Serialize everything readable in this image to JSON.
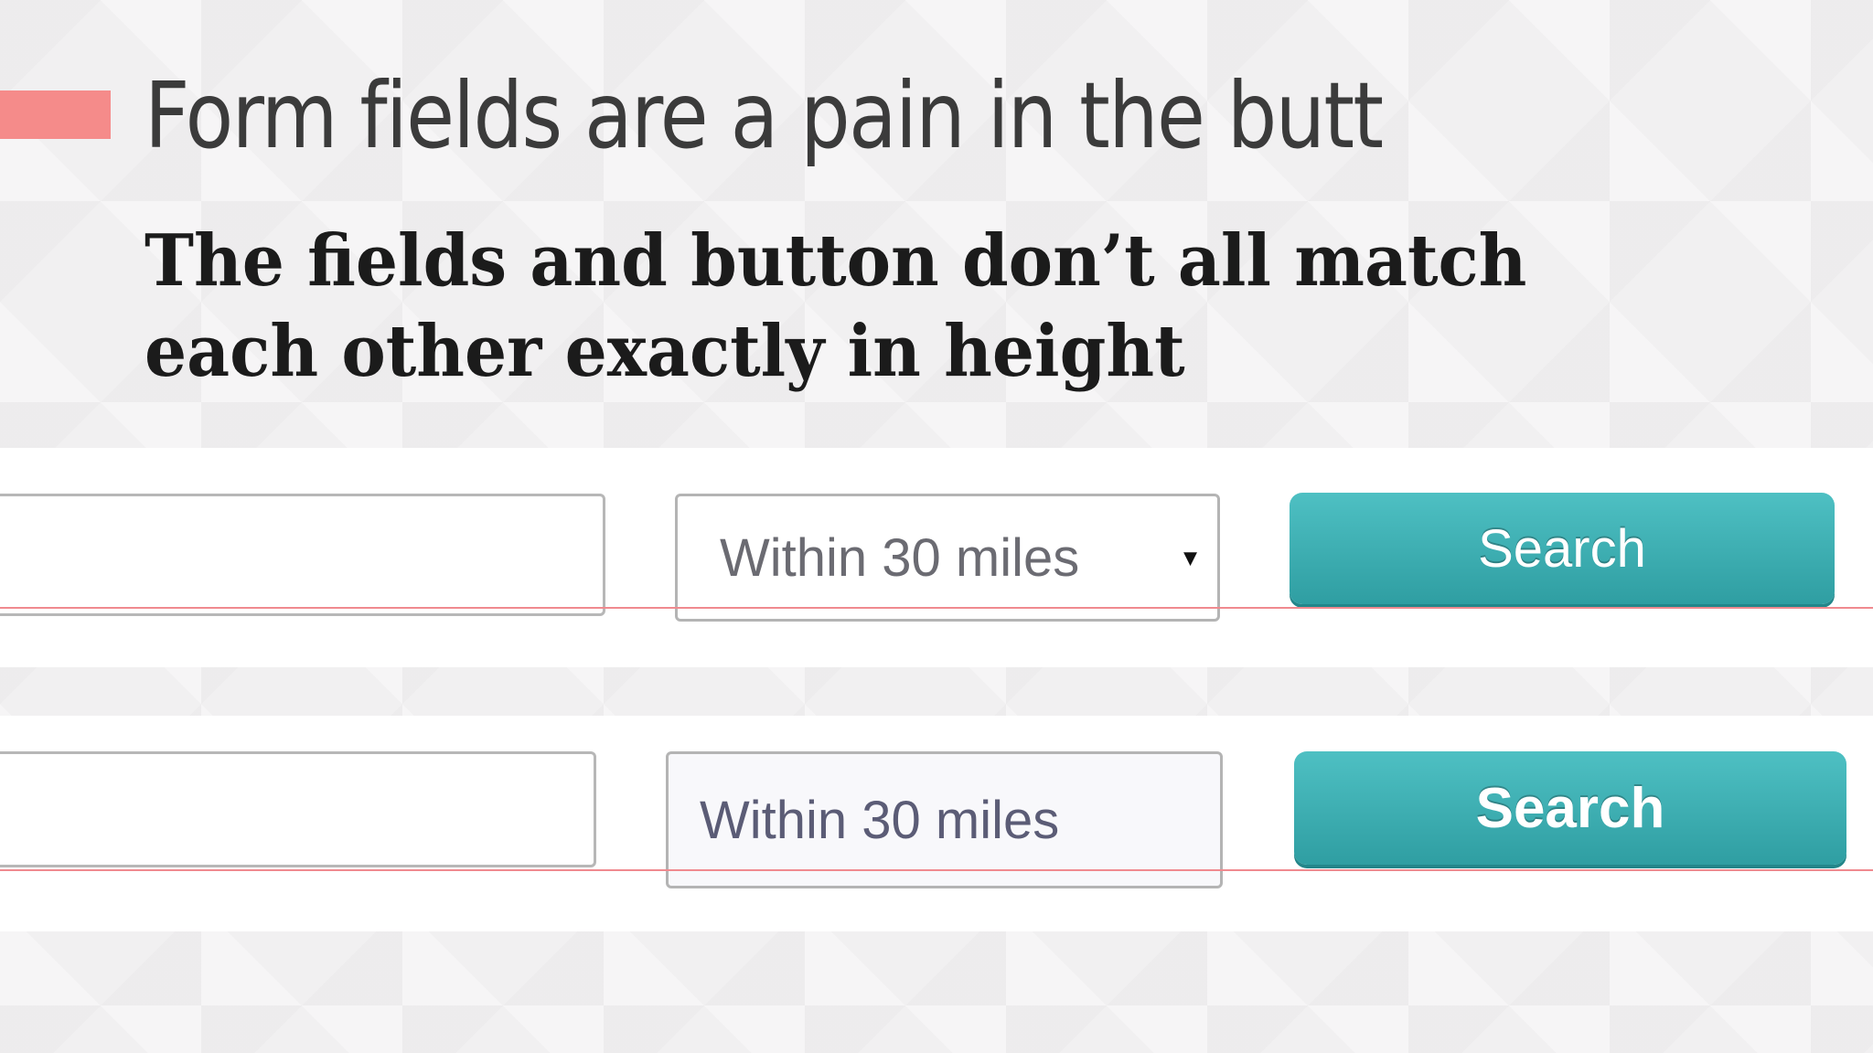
{
  "slide": {
    "title": "Form fields are a pain in the butt",
    "subtitle": "The fields and button don’t all match each other exactly in height",
    "accent_color": "#f58b8a"
  },
  "demos": [
    {
      "input_value": "",
      "select_value": "Within 30 miles",
      "select_arrow": "▾",
      "button_label": "Search",
      "guide_color": "#f08a8f"
    },
    {
      "input_value": "",
      "select_value": "Within 30 miles",
      "button_label": "Search",
      "guide_color": "#f08a8f"
    }
  ],
  "colors": {
    "button_teal": "#3aafb2",
    "background": "#f1f0f1"
  }
}
